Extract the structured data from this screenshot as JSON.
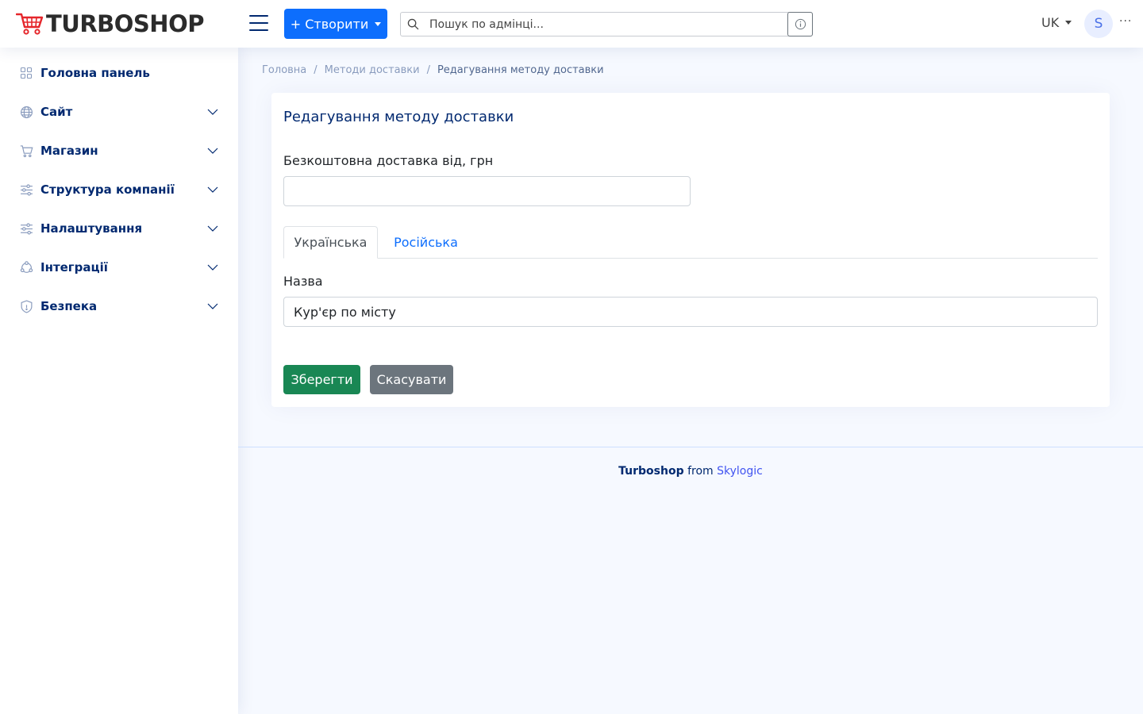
{
  "header": {
    "logo_text": "TURBOSHOP",
    "create_label": "+ Створити",
    "search_placeholder": "Пошук по адмінці...",
    "language": "UK",
    "avatar_initial": "S",
    "more_label": "···"
  },
  "sidebar": {
    "items": [
      {
        "label": "Головна панель",
        "icon": "grid-icon",
        "expandable": false
      },
      {
        "label": "Сайт",
        "icon": "globe-icon",
        "expandable": true
      },
      {
        "label": "Магазин",
        "icon": "cart-icon",
        "expandable": true
      },
      {
        "label": "Структура компанії",
        "icon": "sliders-icon",
        "expandable": true
      },
      {
        "label": "Налаштування",
        "icon": "sliders-icon",
        "expandable": true
      },
      {
        "label": "Інтеграції",
        "icon": "integration-icon",
        "expandable": true
      },
      {
        "label": "Безпека",
        "icon": "shield-icon",
        "expandable": true
      }
    ]
  },
  "breadcrumb": {
    "items": [
      "Головна",
      "Методи доставки",
      "Редагування методу доставки"
    ],
    "separator": "/"
  },
  "form": {
    "title": "Редагування методу доставки",
    "free_delivery_label": "Безкоштовна доставка від, грн",
    "free_delivery_value": "",
    "tabs": [
      {
        "label": "Українська",
        "active": true
      },
      {
        "label": "Російська",
        "active": false
      }
    ],
    "name_label": "Назва",
    "name_value": "Кур'єр по місту",
    "save_label": "Зберегти",
    "cancel_label": "Скасувати"
  },
  "footer": {
    "brand": "Turboshop",
    "from": "from",
    "company": "Skylogic"
  },
  "colors": {
    "primary": "#0d6efd",
    "success": "#198754",
    "secondary": "#6c757d",
    "nav_text": "#012970",
    "logo_red": "#e5262b"
  }
}
